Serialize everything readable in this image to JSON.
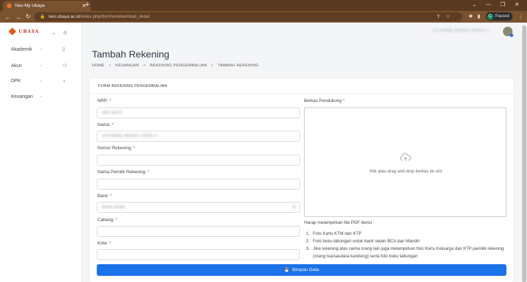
{
  "browser": {
    "tab_title": "Neo My Ubaya",
    "tab_close": "✕",
    "new_tab": "+",
    "url_host": "neo.ubaya.ac.id",
    "url_path": "/index.php/finmhsrekkembali_detail",
    "profile_initial": "C",
    "profile_status": "Paused",
    "icons": [
      "back-icon",
      "forward-icon",
      "reload-icon",
      "lock-icon",
      "share-icon",
      "star-icon",
      "extensions-icon",
      "sidepanel-icon",
      "kebab-icon"
    ]
  },
  "sidebar": {
    "logo_text": "UBAYA",
    "items": [
      {
        "label": "Akademik",
        "icon": "book-icon"
      },
      {
        "label": "Akun",
        "icon": "user-icon"
      },
      {
        "label": "DPK",
        "icon": "award-icon"
      },
      {
        "label": "Keuangan",
        "icon": ""
      }
    ]
  },
  "header": {
    "user_name": "CATHRINE ABIGAIL CHRISTY"
  },
  "page": {
    "title": "Tambah Rekening",
    "breadcrumb": [
      "HOME",
      "KEUANGAN",
      "REKENING PENGEMBALIAN",
      "TAMBAH REKENING"
    ],
    "breadcrumb_sep": ">"
  },
  "form": {
    "header": "FORM REKENING PENGEMBALIAN",
    "nrp_label": "NRP:",
    "nrp_value": "160718078",
    "nama_label": "Nama:",
    "nama_value": "CATHRINE ABIGAIL CHRISTY",
    "norek_label": "Nomor Rekening:",
    "norek_value": "",
    "pemilik_label": "Nama Pemilik Rekening:",
    "pemilik_value": "",
    "bank_label": "Bank:",
    "bank_value": "BANK BANK",
    "cabang_label": "Cabang:",
    "cabang_value": "",
    "kota_label": "Kota:",
    "kota_value": "",
    "required_mark": "*",
    "berkas_label": "Berkas Pendukung",
    "dropzone_text": "Klik atau drag and drop berkas ke sini",
    "note": "Harap melampirkan file PDF berisi :",
    "requirements": [
      "Foto Kartu KTM dan KTP",
      "Foto buku tabungan untuk bank selain BCA dan Mandiri",
      "Jika rekening atas nama orang lain juga melampirkan foto Kartu Keluarga dan KTP pemilik rekening (orang tua/saudara kandung) serta foto buku tabungan"
    ],
    "submit_label": "Simpan Data"
  }
}
